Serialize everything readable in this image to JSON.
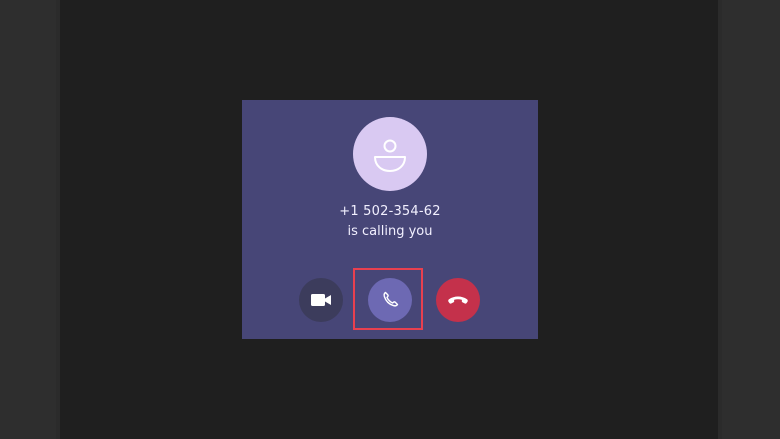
{
  "incoming_call": {
    "caller_number": "+1 502-354-62",
    "status_text": "is calling you",
    "avatar_icon": "person-icon",
    "buttons": {
      "video": {
        "icon": "video-camera-icon"
      },
      "audio": {
        "icon": "phone-icon",
        "highlighted": true
      },
      "decline": {
        "icon": "hang-up-icon"
      }
    }
  },
  "colors": {
    "card_background": "#474677",
    "avatar_background": "#d9c9f2",
    "accept_audio": "#6d69b3",
    "decline": "#c4314b",
    "highlight": "#e8404f"
  }
}
